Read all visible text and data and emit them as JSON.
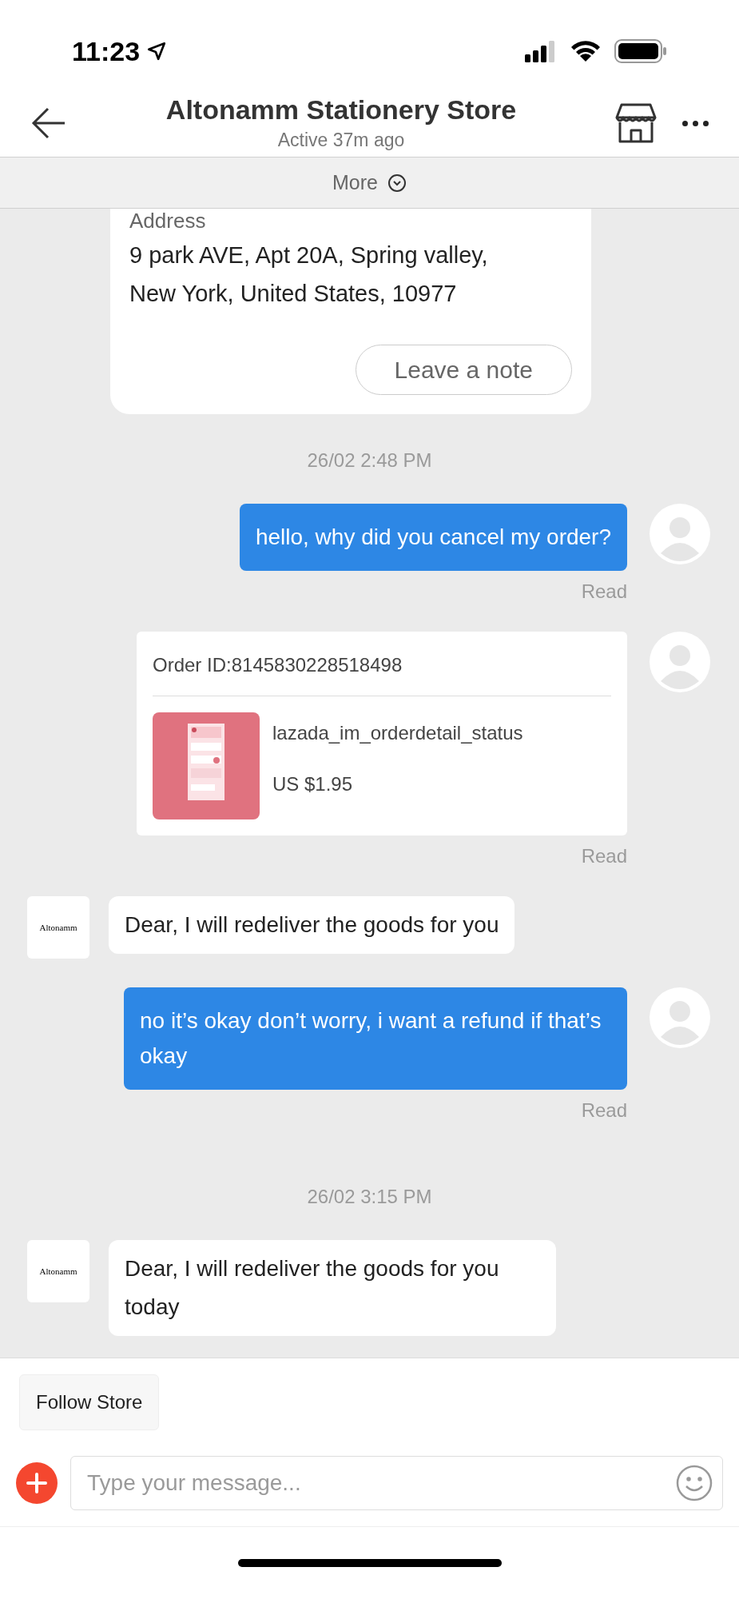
{
  "status_bar": {
    "time": "11:23"
  },
  "header": {
    "title": "Altonamm Stationery Store",
    "subtitle": "Active 37m ago",
    "more": "More"
  },
  "address_card": {
    "label": "Address",
    "lines": "9 park AVE, Apt 20A, Spring valley, New York, United States, 10977",
    "button": "Leave a note"
  },
  "messages": [
    {
      "kind": "time",
      "text": "26/02 2:48 PM"
    },
    {
      "kind": "outgoing",
      "text": "hello, why did you cancel my order?",
      "status": "Read"
    },
    {
      "kind": "order",
      "order_id": "Order ID:8145830228518498",
      "product": "lazada_im_orderdetail_status",
      "price": "US $1.95",
      "status": "Read"
    },
    {
      "kind": "incoming",
      "avatar": "Altonamm",
      "text": "Dear, I will redeliver the goods for you"
    },
    {
      "kind": "outgoing",
      "text": "no it’s okay don’t worry, i want a refund if that’s okay",
      "status": "Read"
    },
    {
      "kind": "time",
      "text": "26/02 3:15 PM"
    },
    {
      "kind": "incoming",
      "avatar": "Altonamm",
      "text": "Dear, I will redeliver the goods for you today"
    }
  ],
  "follow_button": "Follow Store",
  "composer": {
    "placeholder": "Type your message..."
  }
}
